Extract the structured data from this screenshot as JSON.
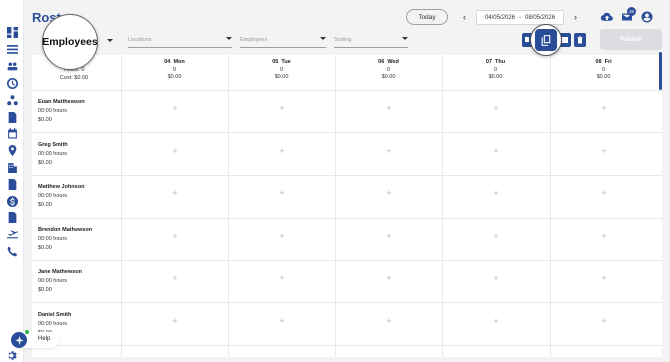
{
  "app": {
    "title": "Roster"
  },
  "header": {
    "today_label": "Today",
    "date_start": "04/05/2026",
    "date_sep": "-",
    "date_end": "08/05/2026",
    "notification_count": "26"
  },
  "filters": {
    "view_label": "Employees",
    "locations_placeholder": "Locations",
    "employees_placeholder": "Employees",
    "sorting_placeholder": "Sorting",
    "publish_label": "Publish"
  },
  "summary": {
    "hours": "Hours: 0",
    "cost": "Cost: $0.00"
  },
  "days": [
    {
      "date": "04",
      "day": "Mon",
      "count": "0",
      "cost": "$0.00"
    },
    {
      "date": "05",
      "day": "Tue",
      "count": "0",
      "cost": "$0.00"
    },
    {
      "date": "06",
      "day": "Wed",
      "count": "0",
      "cost": "$0.00"
    },
    {
      "date": "07",
      "day": "Thu",
      "count": "0",
      "cost": "$0.00"
    },
    {
      "date": "08",
      "day": "Fri",
      "count": "0",
      "cost": "$0.00"
    }
  ],
  "employees": [
    {
      "name": "Euan Matthewson",
      "hours": "00:00 hours",
      "cost": "$0.00"
    },
    {
      "name": "Greg Smith",
      "hours": "00:00 hours",
      "cost": "$0.00"
    },
    {
      "name": "Matthew Johnson",
      "hours": "00:00 hours",
      "cost": "$0.00"
    },
    {
      "name": "Brendon Mathewson",
      "hours": "00:00 hours",
      "cost": "$0.00"
    },
    {
      "name": "Jane Mathewson",
      "hours": "00:00 hours",
      "cost": "$0.00"
    },
    {
      "name": "Daniel Smith",
      "hours": "00:00 hours",
      "cost": "$0.00"
    }
  ],
  "cell_add_symbol": "+",
  "help": {
    "label": "Help"
  },
  "colors": {
    "accent": "#2a4d9a",
    "publish_disabled": "#dcdde0",
    "status_online": "#2db34a"
  },
  "icons": {
    "sidebar": [
      "dashboard-icon",
      "list-icon",
      "people-icon",
      "clock-icon",
      "org-chart-icon",
      "timesheet-icon",
      "calendar-icon",
      "location-pin-icon",
      "building-icon",
      "document-icon",
      "dollar-icon",
      "report-icon",
      "plane-icon",
      "phone-icon"
    ],
    "header": [
      "cloud-upload-icon",
      "mail-icon",
      "account-icon"
    ],
    "toolbar": [
      "copy-icon",
      "expand-icon",
      "delete-icon"
    ]
  }
}
